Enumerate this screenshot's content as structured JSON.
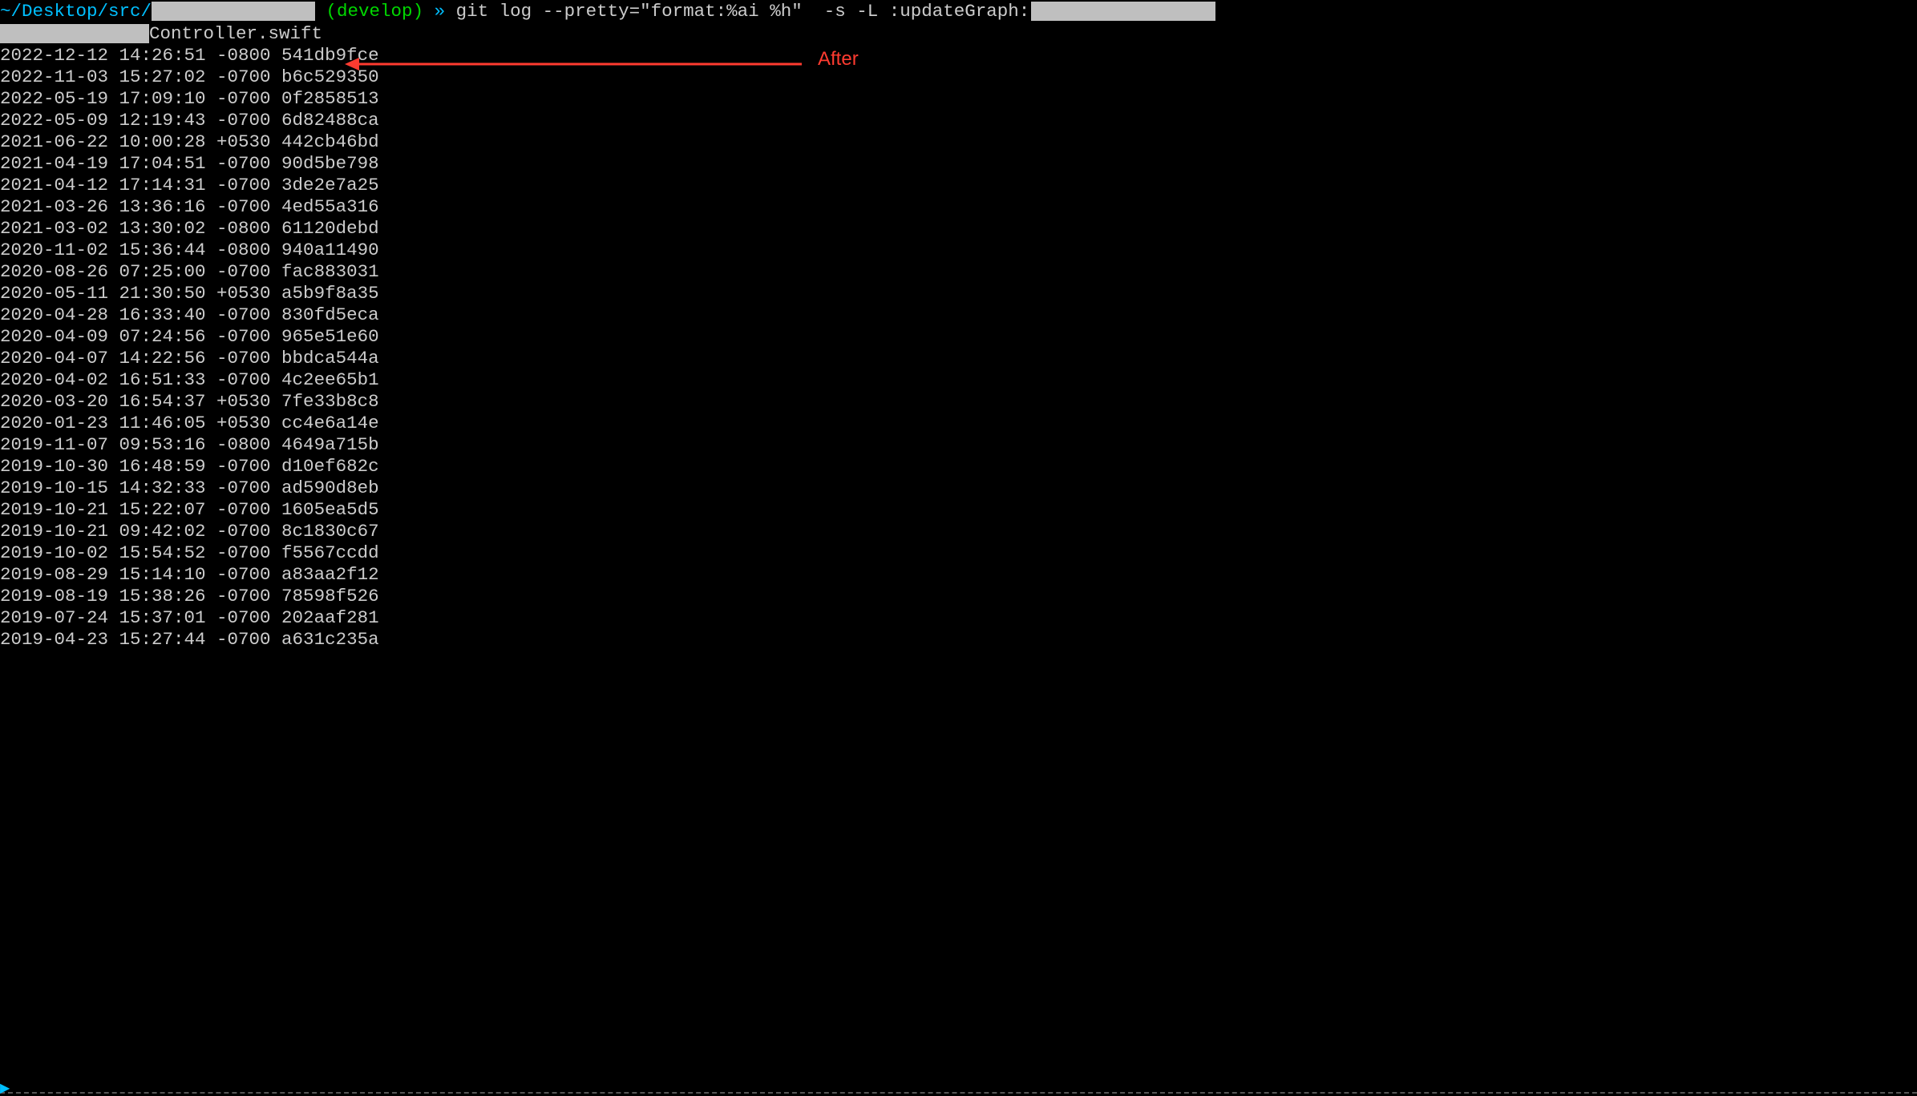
{
  "prompt": {
    "cwd": "~/Desktop/src/",
    "branch": "(develop)",
    "arrow": "»",
    "command": "git log --pretty=\"format:%ai %h\"  -s -L :updateGraph:"
  },
  "wrap_suffix": "Controller.swift",
  "annotation": {
    "label": "After",
    "arrow_color": "#ff3b30"
  },
  "log_lines": [
    "2022-12-12 14:26:51 -0800 541db9fce",
    "2022-11-03 15:27:02 -0700 b6c529350",
    "2022-05-19 17:09:10 -0700 0f2858513",
    "2022-05-09 12:19:43 -0700 6d82488ca",
    "2021-06-22 10:00:28 +0530 442cb46bd",
    "2021-04-19 17:04:51 -0700 90d5be798",
    "2021-04-12 17:14:31 -0700 3de2e7a25",
    "2021-03-26 13:36:16 -0700 4ed55a316",
    "2021-03-02 13:30:02 -0800 61120debd",
    "2020-11-02 15:36:44 -0800 940a11490",
    "2020-08-26 07:25:00 -0700 fac883031",
    "2020-05-11 21:30:50 +0530 a5b9f8a35",
    "2020-04-28 16:33:40 -0700 830fd5eca",
    "2020-04-09 07:24:56 -0700 965e51e60",
    "2020-04-07 14:22:56 -0700 bbdca544a",
    "2020-04-02 16:51:33 -0700 4c2ee65b1",
    "2020-03-20 16:54:37 +0530 7fe33b8c8",
    "2020-01-23 11:46:05 +0530 cc4e6a14e",
    "2019-11-07 09:53:16 -0800 4649a715b",
    "2019-10-30 16:48:59 -0700 d10ef682c",
    "2019-10-15 14:32:33 -0700 ad590d8eb",
    "2019-10-21 15:22:07 -0700 1605ea5d5",
    "2019-10-21 09:42:02 -0700 8c1830c67",
    "2019-10-02 15:54:52 -0700 f5567ccdd",
    "2019-08-29 15:14:10 -0700 a83aa2f12",
    "2019-08-19 15:38:26 -0700 78598f526",
    "2019-07-24 15:37:01 -0700 202aaf281",
    "2019-04-23 15:27:44 -0700 a631c235a"
  ]
}
